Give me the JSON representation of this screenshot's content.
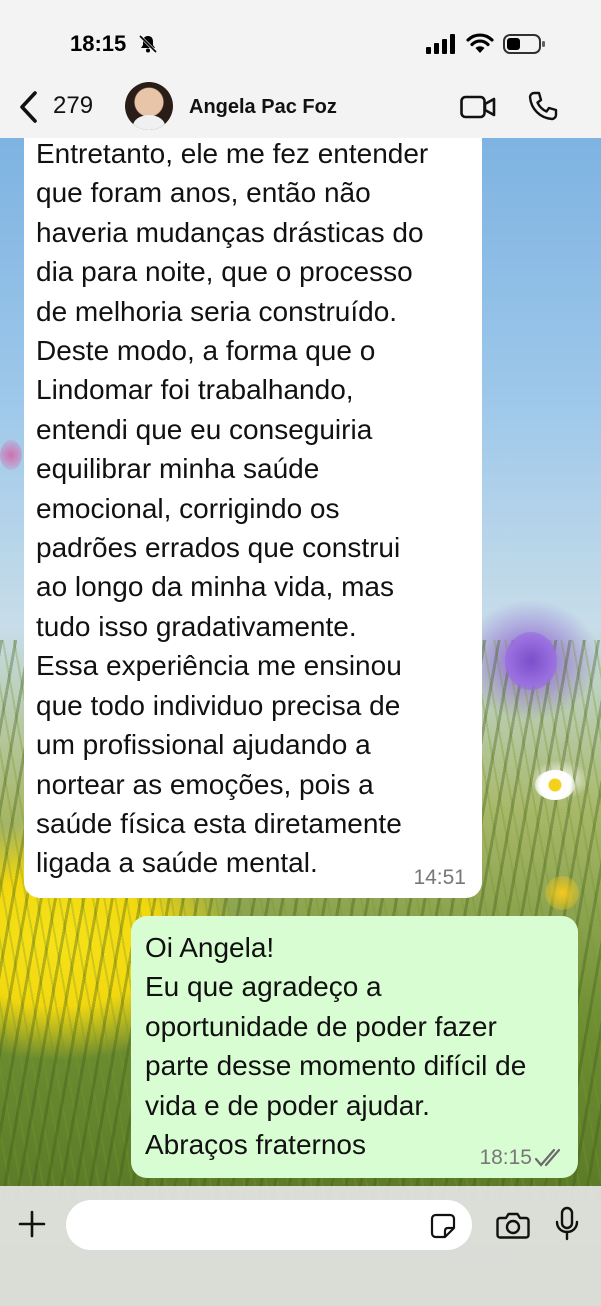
{
  "status_bar": {
    "time": "18:15",
    "icons": [
      "bell-off-icon",
      "signal-icon",
      "wifi-icon",
      "battery-icon"
    ]
  },
  "header": {
    "back_count": "279",
    "contact_name": "Angela Pac Foz",
    "icons": [
      "back-chevron-icon",
      "video-call-icon",
      "phone-call-icon"
    ]
  },
  "messages": [
    {
      "direction": "incoming",
      "text": "Entretanto, ele me fez entender\nque foram anos, então não\nhaveria mudanças drásticas do\ndia para noite, que o processo\nde melhoria seria construído.\nDeste modo, a forma que o\nLindomar foi trabalhando,\nentendi que eu conseguiria\nequilibrar minha saúde\nemocional, corrigindo os\npadrões errados que construi\nao longo da minha vida, mas\ntudo isso gradativamente.\nEssa experiência me ensinou\nque todo individuo precisa de\num profissional ajudando a\nnortear as emoções, pois a\nsaúde física esta diretamente\nligada a saúde mental.",
      "time": "14:51"
    },
    {
      "direction": "outgoing",
      "text": "Oi Angela!\nEu que agradeço a\noportunidade de poder fazer\nparte desse momento difícil de\nvida e de poder ajudar.\nAbraços fraternos",
      "time": "18:15",
      "status": "read"
    }
  ],
  "composer": {
    "value": "",
    "placeholder": "",
    "icons": [
      "plus-icon",
      "sticker-icon",
      "camera-icon",
      "microphone-icon"
    ]
  },
  "colors": {
    "outgoing_bubble": "#d9fdd3",
    "incoming_bubble": "#ffffff",
    "bar_background": "#f3f3f3"
  }
}
